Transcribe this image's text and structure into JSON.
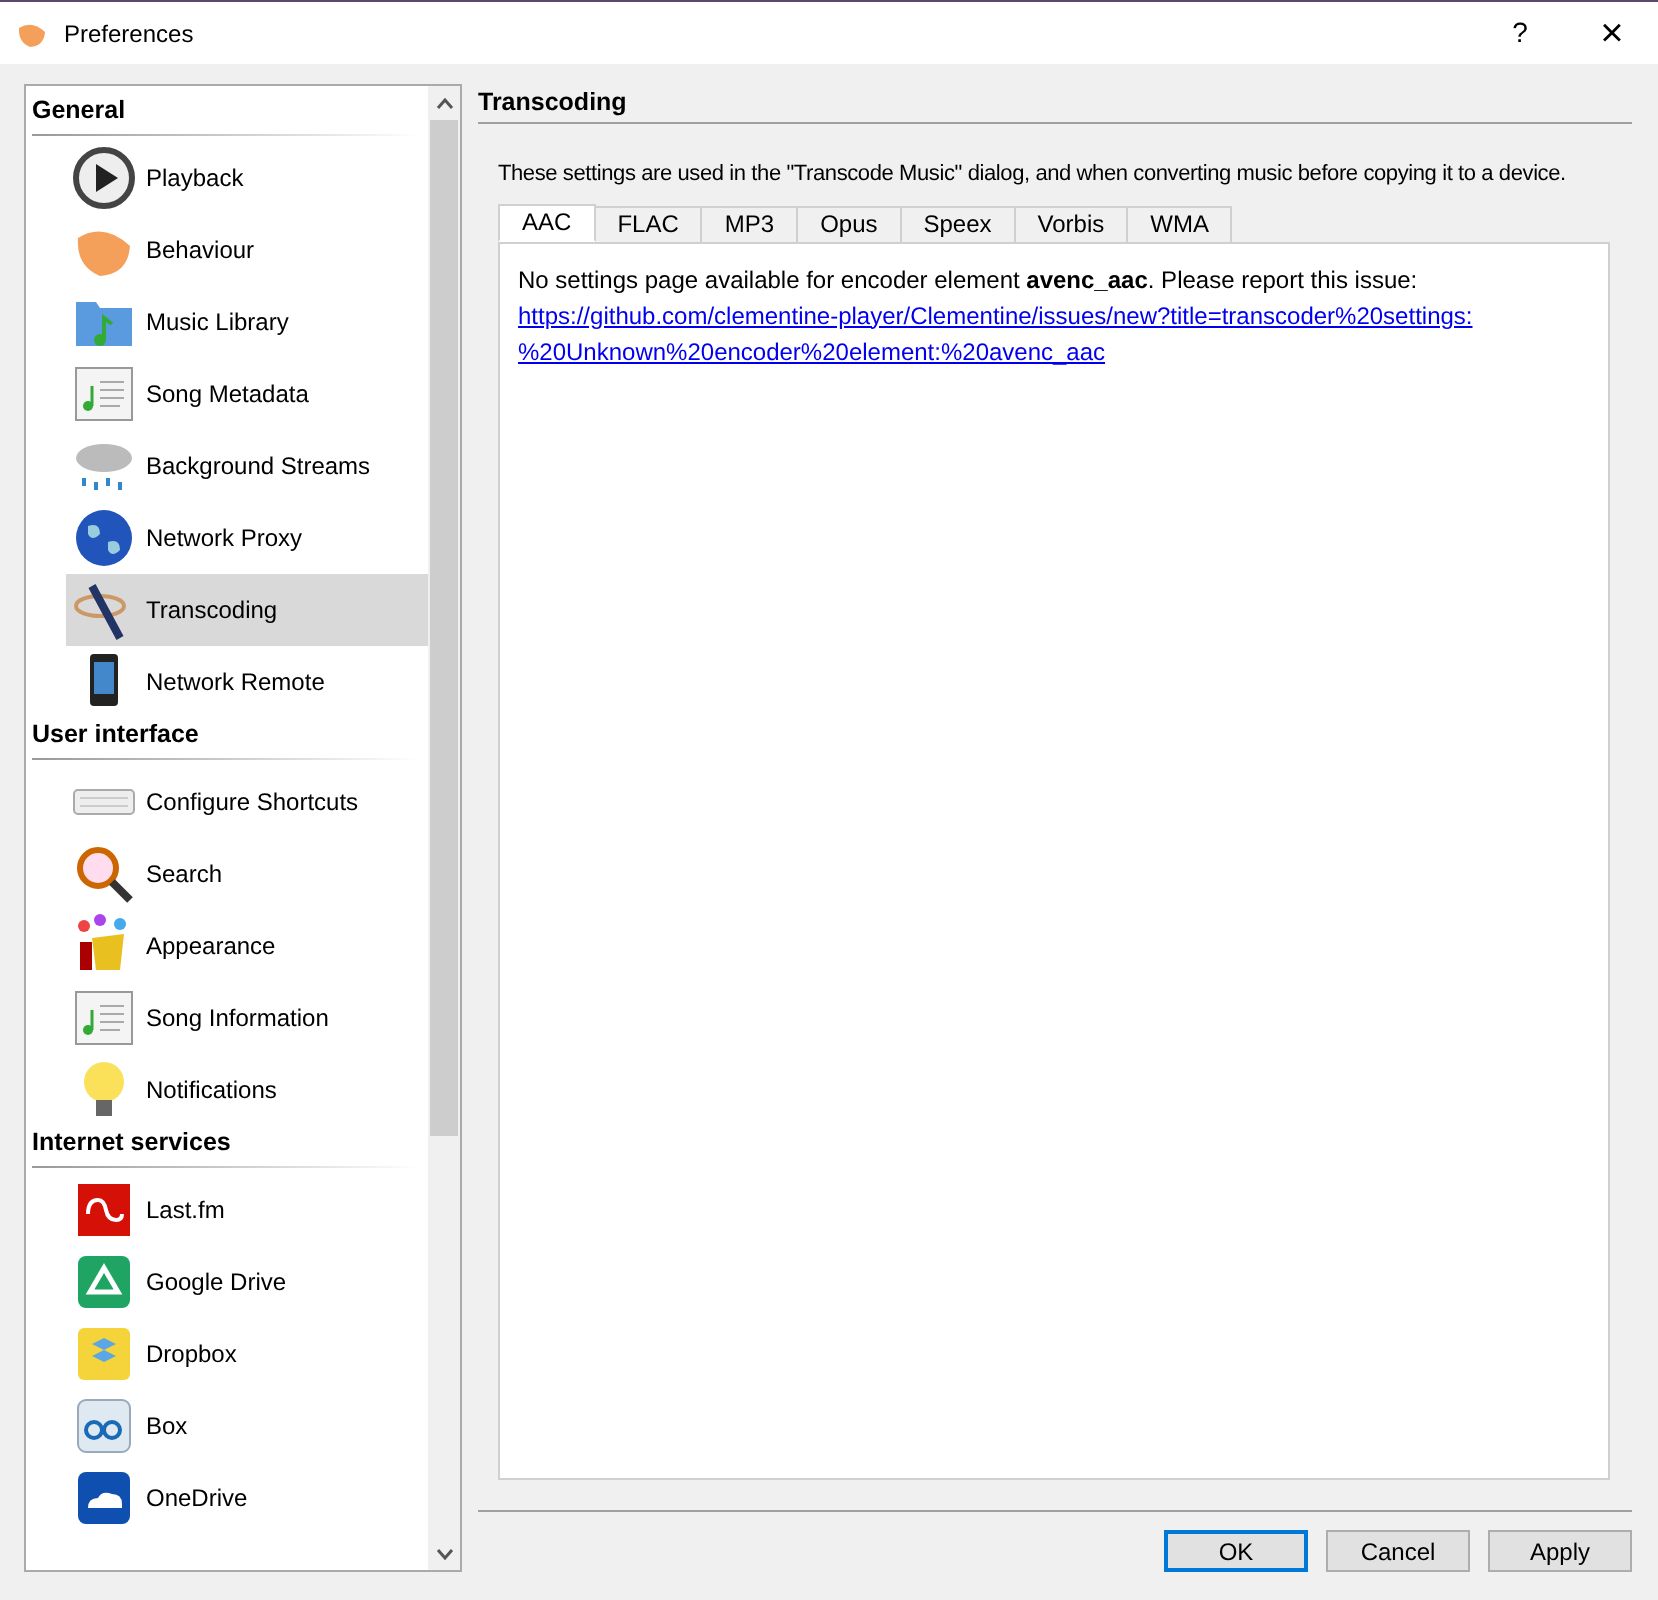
{
  "window": {
    "title": "Preferences",
    "help": "?",
    "close": "×"
  },
  "sidebar": {
    "groups": [
      {
        "title": "General",
        "items": [
          {
            "label": "Playback",
            "selected": false
          },
          {
            "label": "Behaviour",
            "selected": false
          },
          {
            "label": "Music Library",
            "selected": false
          },
          {
            "label": "Song Metadata",
            "selected": false
          },
          {
            "label": "Background Streams",
            "selected": false
          },
          {
            "label": "Network Proxy",
            "selected": false
          },
          {
            "label": "Transcoding",
            "selected": true
          },
          {
            "label": "Network Remote",
            "selected": false
          }
        ]
      },
      {
        "title": "User interface",
        "items": [
          {
            "label": "Configure Shortcuts",
            "selected": false
          },
          {
            "label": "Search",
            "selected": false
          },
          {
            "label": "Appearance",
            "selected": false
          },
          {
            "label": "Song Information",
            "selected": false
          },
          {
            "label": "Notifications",
            "selected": false
          }
        ]
      },
      {
        "title": "Internet services",
        "items": [
          {
            "label": "Last.fm",
            "selected": false
          },
          {
            "label": "Google Drive",
            "selected": false
          },
          {
            "label": "Dropbox",
            "selected": false
          },
          {
            "label": "Box",
            "selected": false
          },
          {
            "label": "OneDrive",
            "selected": false
          }
        ]
      }
    ]
  },
  "page": {
    "title": "Transcoding",
    "description": "These settings are used in the \"Transcode Music\" dialog, and when converting music before copying it to a device.",
    "tabs": [
      {
        "label": "AAC",
        "selected": true
      },
      {
        "label": "FLAC",
        "selected": false
      },
      {
        "label": "MP3",
        "selected": false
      },
      {
        "label": "Opus",
        "selected": false
      },
      {
        "label": "Speex",
        "selected": false
      },
      {
        "label": "Vorbis",
        "selected": false
      },
      {
        "label": "WMA",
        "selected": false
      }
    ],
    "message": "No settings page available for encoder element **avenc_aac**. Please report this issue:",
    "link_lines": [
      "https://github.com/clementine-player/Clementine/issues/new?title=transcoder%20settings:",
      "%20Unknown%20encoder%20element:%20avenc_aac"
    ]
  },
  "buttons": [
    {
      "label": "OK",
      "selected": true
    },
    {
      "label": "Cancel",
      "selected": false
    },
    {
      "label": "Apply",
      "selected": false
    }
  ]
}
